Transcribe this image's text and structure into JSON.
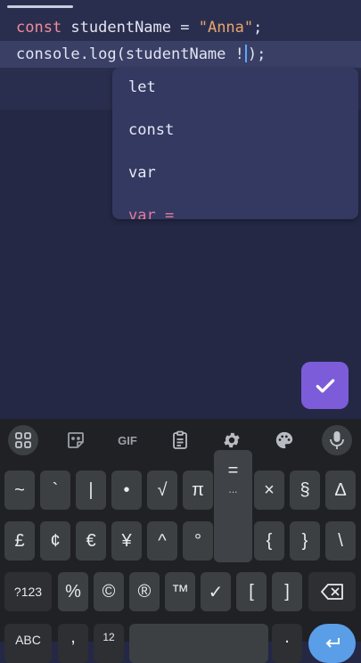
{
  "editor": {
    "line1": {
      "kw": "const",
      "name": " studentName = ",
      "str": "\"Anna\"",
      "end": ";"
    },
    "line2": {
      "before": "console.log(studentName !",
      "after": ");"
    }
  },
  "autocomplete": {
    "items": [
      "let",
      "const",
      "var",
      "var ="
    ]
  },
  "keyboard": {
    "toolbar": {
      "gif_label": "GIF"
    },
    "row1": [
      "~",
      "`",
      "|",
      "•",
      "√",
      "π",
      "=",
      "×",
      "§",
      "Δ"
    ],
    "row1_popup_hint": "...",
    "row2": [
      "£",
      "¢",
      "€",
      "¥",
      "^",
      "°",
      "{",
      "}",
      "\\"
    ],
    "row3": {
      "mode_label": "?123",
      "keys": [
        "%",
        "©",
        "®",
        "™",
        "✓",
        "[",
        "]"
      ]
    },
    "row4": {
      "abc_label": "ABC",
      "comma": ",",
      "numpad_label": "12",
      "period": "."
    }
  },
  "colors": {
    "accent": "#7c5cd8",
    "keyword": "#f28b9b",
    "string": "#e8a56b"
  }
}
